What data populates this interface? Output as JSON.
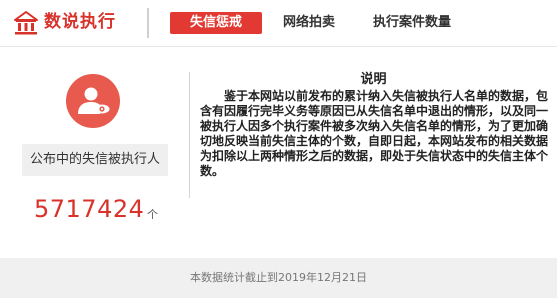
{
  "header": {
    "logo_text": "数说执行",
    "tabs": [
      {
        "label": "失信惩戒",
        "active": true
      },
      {
        "label": "网络拍卖",
        "active": false
      },
      {
        "label": "执行案件数量",
        "active": false
      }
    ]
  },
  "stats": {
    "icon": "person-eye-icon",
    "label": "公布中的失信被执行人",
    "value": "5717424",
    "unit": "个"
  },
  "explanation": {
    "title": "说明",
    "body": "鉴于本网站以前发布的累计纳入失信被执行人名单的数据，包含有因履行完毕义务等原因已从失信名单中退出的情形，以及同一被执行人因多个执行案件被多次纳入失信名单的情形，为了更加确切地反映当前失信主体的个数，自即日起，本网站发布的相关数据为扣除以上两种情形之后的数据，即处于失信状态中的失信主体个数。"
  },
  "footer": {
    "text": "本数据统计截止到2019年12月21日"
  },
  "colors": {
    "brand_red": "#d8322b",
    "tab_active_bg": "#e23a32",
    "icon_circle": "#e8594e",
    "footer_bg": "#f0f0f0"
  }
}
